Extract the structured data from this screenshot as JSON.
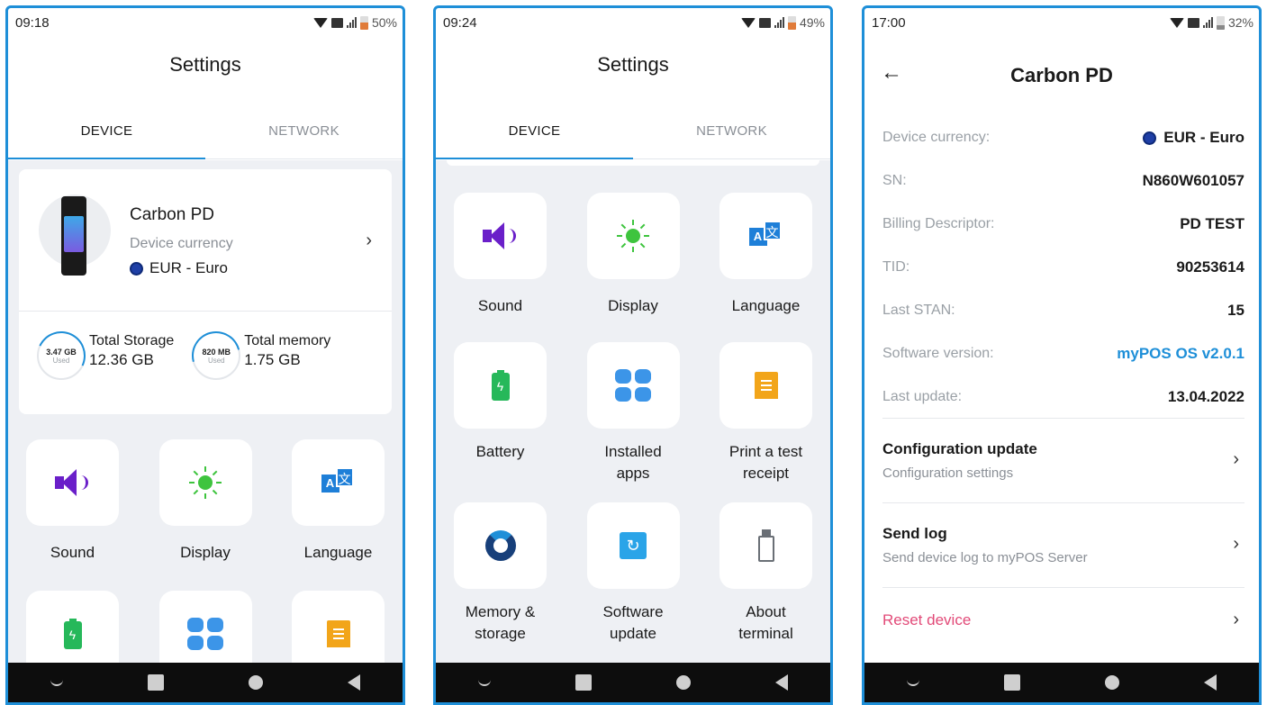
{
  "colors": {
    "accent": "#1e8fd8",
    "danger": "#e24a78",
    "bg_gray": "#eef0f4",
    "navbar": "#0d0d0d"
  },
  "screen1": {
    "status": {
      "time": "09:18",
      "battery": "50%",
      "battery_level": 0.5
    },
    "title": "Settings",
    "tabs": [
      {
        "label": "DEVICE",
        "active": true
      },
      {
        "label": "NETWORK",
        "active": false
      }
    ],
    "device_card": {
      "name": "Carbon PD",
      "currency_label": "Device currency",
      "currency_value": "EUR - Euro",
      "storage": {
        "gauge_value": "3.47 GB",
        "gauge_sub": "Used",
        "label": "Total Storage",
        "value": "12.36 GB",
        "used_fraction": 0.28
      },
      "memory": {
        "gauge_value": "820 MB",
        "gauge_sub": "Used",
        "label": "Total memory",
        "value": "1.75 GB",
        "used_fraction": 0.46
      }
    },
    "tiles": [
      {
        "label": "Sound",
        "icon": "speaker-icon"
      },
      {
        "label": "Display",
        "icon": "sun-icon"
      },
      {
        "label": "Language",
        "icon": "translate-icon"
      },
      {
        "label": "",
        "icon": "battery-icon"
      },
      {
        "label": "",
        "icon": "apps-grid-icon"
      },
      {
        "label": "",
        "icon": "receipt-icon"
      }
    ]
  },
  "screen2": {
    "status": {
      "time": "09:24",
      "battery": "49%",
      "battery_level": 0.49
    },
    "title": "Settings",
    "tabs": [
      {
        "label": "DEVICE",
        "active": true
      },
      {
        "label": "NETWORK",
        "active": false
      }
    ],
    "tiles": [
      {
        "label": "Sound",
        "icon": "speaker-icon"
      },
      {
        "label": "Display",
        "icon": "sun-icon"
      },
      {
        "label": "Language",
        "icon": "translate-icon"
      },
      {
        "label": "Battery",
        "icon": "battery-icon"
      },
      {
        "label_line1": "Installed",
        "label_line2": "apps",
        "icon": "apps-grid-icon"
      },
      {
        "label_line1": "Print a test",
        "label_line2": "receipt",
        "icon": "receipt-icon"
      },
      {
        "label_line1": "Memory &",
        "label_line2": "storage",
        "icon": "memory-pie-icon"
      },
      {
        "label_line1": "Software",
        "label_line2": "update",
        "icon": "refresh-icon"
      },
      {
        "label_line1": "About",
        "label_line2": "terminal",
        "icon": "terminal-icon"
      }
    ]
  },
  "screen3": {
    "status": {
      "time": "17:00",
      "battery": "32%",
      "battery_level": 0.32
    },
    "title": "Carbon PD",
    "details": [
      {
        "label": "Device currency:",
        "value": "EUR - Euro"
      },
      {
        "label": "SN:",
        "value": "N860W601057"
      },
      {
        "label": "Billing Descriptor:",
        "value": "PD TEST"
      },
      {
        "label": "TID:",
        "value": "90253614"
      },
      {
        "label": "Last STAN:",
        "value": "15"
      },
      {
        "label": "Software version:",
        "value": "myPOS OS v2.0.1"
      },
      {
        "label": "Last update:",
        "value": "13.04.2022"
      }
    ],
    "menu": [
      {
        "title": "Configuration update",
        "subtitle": "Configuration settings"
      },
      {
        "title": "Send log",
        "subtitle": "Send device log to myPOS Server"
      },
      {
        "title": "Reset device",
        "subtitle": ""
      }
    ]
  }
}
